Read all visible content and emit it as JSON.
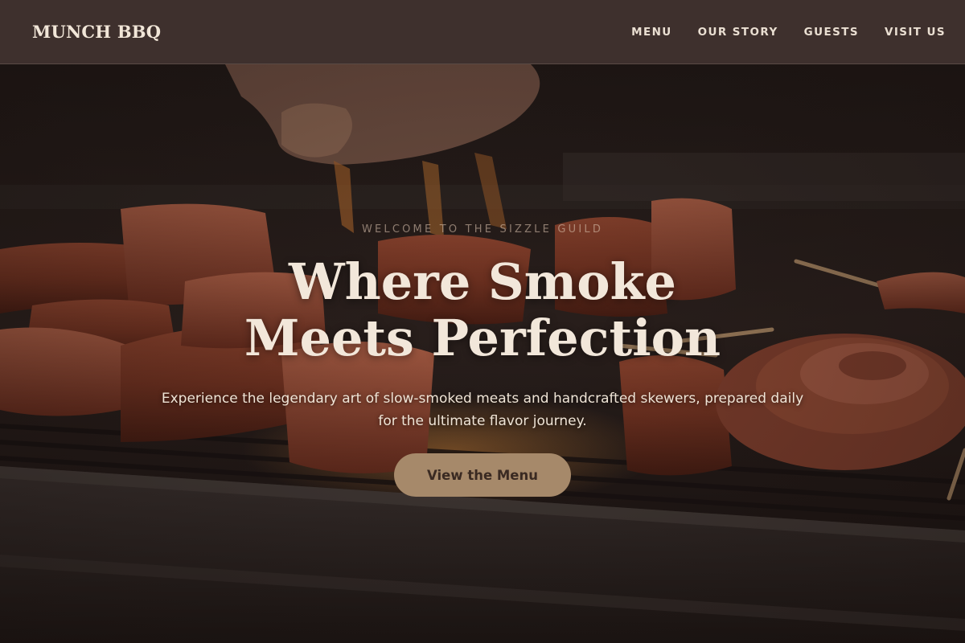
{
  "header": {
    "brand": "MUNCH BBQ",
    "nav": [
      "MENU",
      "OUR STORY",
      "GUESTS",
      "VISIT US"
    ]
  },
  "hero": {
    "eyebrow": "WELCOME TO THE SIZZLE GUILD",
    "headline": "Where Smoke Meets Perfection",
    "subhead": "Experience the legendary art of slow-smoked meats and handcrafted skewers, prepared daily for the ultimate flavor journey.",
    "cta_label": "View the Menu",
    "image_subject": "meats and skewers on a grill"
  },
  "colors": {
    "header_bg": "#3e302d",
    "brand_text": "#f1e6d8",
    "cta_bg": "#a6896a",
    "cta_text": "#3a2a22",
    "headline_text": "#f2e7da"
  }
}
